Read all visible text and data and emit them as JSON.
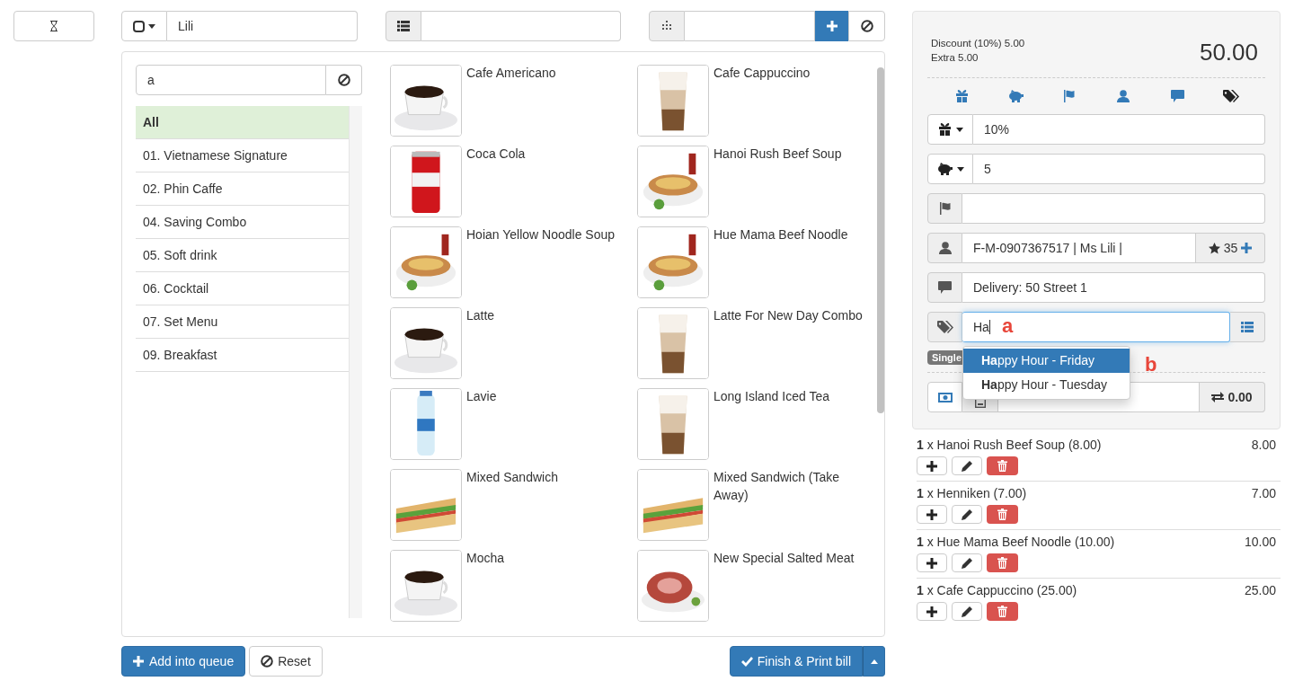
{
  "customer_field": {
    "value": "Lili"
  },
  "category_search": {
    "value": "a"
  },
  "categories": [
    {
      "label": "All",
      "selected": true
    },
    {
      "label": "01. Vietnamese Signature",
      "selected": false
    },
    {
      "label": "02. Phin Caffe",
      "selected": false
    },
    {
      "label": "04. Saving Combo",
      "selected": false
    },
    {
      "label": "05. Soft drink",
      "selected": false
    },
    {
      "label": "06. Cocktail",
      "selected": false
    },
    {
      "label": "07. Set Menu",
      "selected": false
    },
    {
      "label": "09. Breakfast",
      "selected": false
    }
  ],
  "products": [
    {
      "name": "Cafe Americano"
    },
    {
      "name": "Cafe Cappuccino"
    },
    {
      "name": "Coca Cola"
    },
    {
      "name": "Hanoi Rush Beef Soup"
    },
    {
      "name": "Hoian Yellow Noodle Soup"
    },
    {
      "name": "Hue Mama Beef Noodle"
    },
    {
      "name": "Latte"
    },
    {
      "name": "Latte For New Day Combo"
    },
    {
      "name": "Lavie"
    },
    {
      "name": "Long Island Iced Tea"
    },
    {
      "name": "Mixed Sandwich"
    },
    {
      "name": "Mixed Sandwich (Take Away)"
    },
    {
      "name": "Mocha"
    },
    {
      "name": "New Special Salted Meat"
    }
  ],
  "summary": {
    "lines": [
      "Discount (10%) 5.00",
      "Extra 5.00"
    ],
    "total": "50.00"
  },
  "option_tabs": [
    {
      "kind": "gift",
      "selected": false
    },
    {
      "kind": "piggy",
      "selected": false
    },
    {
      "kind": "flag",
      "selected": false
    },
    {
      "kind": "user",
      "selected": false
    },
    {
      "kind": "comment",
      "selected": false
    },
    {
      "kind": "tags",
      "selected": true
    }
  ],
  "fields": [
    {
      "kind": "gift",
      "value": "10%"
    },
    {
      "kind": "piggy",
      "value": "5"
    },
    {
      "kind": "flag"
    },
    {
      "kind": "user",
      "value": "F-M-0907367517 | Ms Lili |",
      "points": "35"
    },
    {
      "kind": "comment",
      "value": "Delivery: 50 Street 1"
    },
    {
      "kind": "tags",
      "value": "Ha",
      "focused": true
    }
  ],
  "badge": "Single",
  "suggestions": [
    {
      "label": "**Ha**ppy Hour - Friday",
      "selected": true
    },
    {
      "label": "**Ha**ppy Hour - Tuesday",
      "selected": false
    }
  ],
  "annotations": [
    "a",
    "b"
  ],
  "payment": {
    "change": "0.00"
  },
  "order_lines": [
    {
      "text": "**1** x Hanoi Rush Beef Soup (8.00)",
      "amount": "8.00"
    },
    {
      "text": "**1** x Henniken (7.00)",
      "amount": "7.00"
    },
    {
      "text": "**1** x Hue Mama Beef Noodle (10.00)",
      "amount": "10.00"
    },
    {
      "text": "**1** x Cafe Cappuccino (25.00)",
      "amount": "25.00"
    }
  ],
  "buttons": {
    "queue": "Add into queue",
    "reset": "Reset",
    "finish": "Finish & Print bill"
  }
}
